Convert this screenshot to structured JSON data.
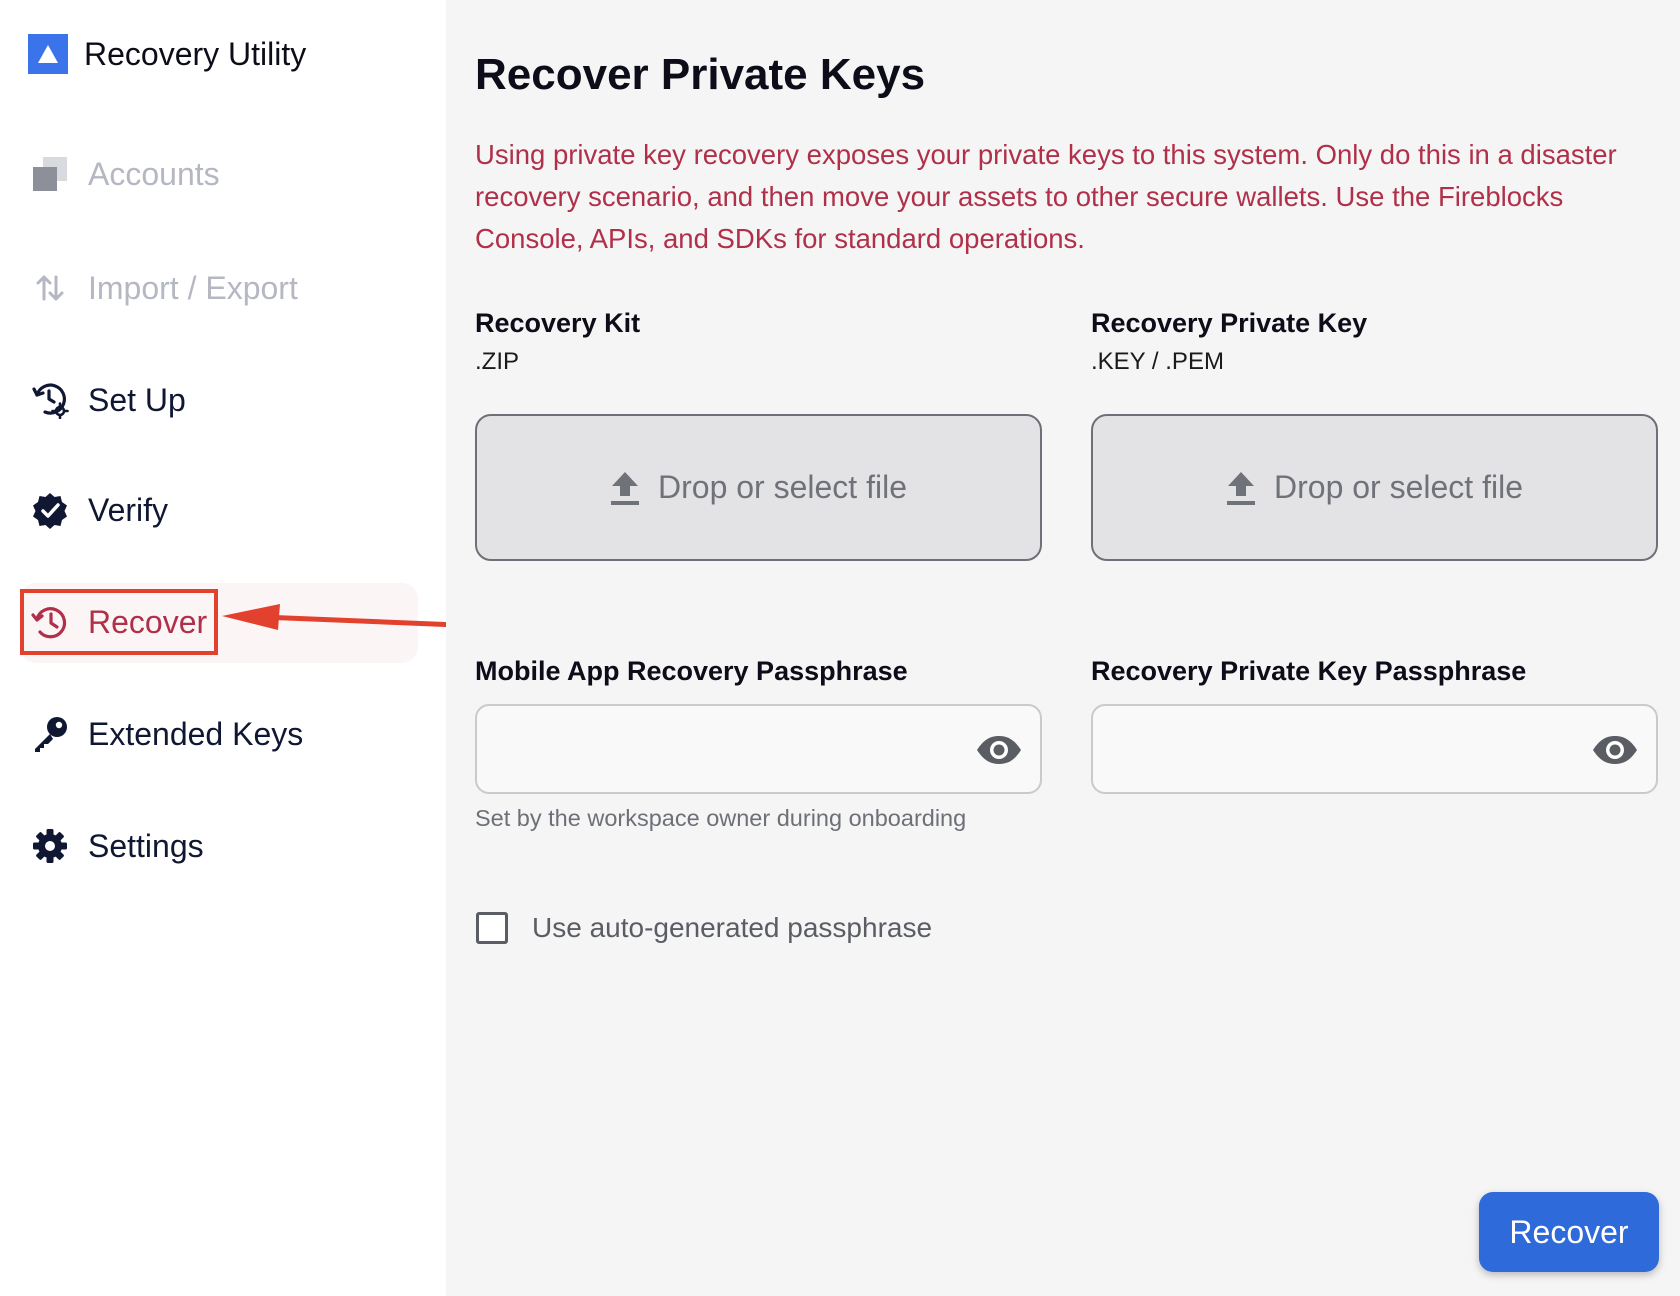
{
  "app": {
    "title": "Recovery Utility"
  },
  "sidebar": {
    "items": [
      {
        "label": "Accounts",
        "icon": "accounts-icon",
        "state": "disabled"
      },
      {
        "label": "Import / Export",
        "icon": "import-export-icon",
        "state": "disabled"
      },
      {
        "label": "Set Up",
        "icon": "setup-icon",
        "state": "normal"
      },
      {
        "label": "Verify",
        "icon": "verified-badge-icon",
        "state": "normal"
      },
      {
        "label": "Recover",
        "icon": "history-icon",
        "state": "active"
      },
      {
        "label": "Extended Keys",
        "icon": "key-icon",
        "state": "normal"
      },
      {
        "label": "Settings",
        "icon": "gear-icon",
        "state": "normal"
      }
    ]
  },
  "main": {
    "title": "Recover Private Keys",
    "warning": "Using private key recovery exposes your private keys to this system. Only do this in a disaster recovery scenario, and then move your assets to other secure wallets. Use the Fireblocks Console, APIs, and SDKs for standard operations.",
    "recovery_kit": {
      "label": "Recovery Kit",
      "formats": ".ZIP",
      "dropzone_text": "Drop or select file"
    },
    "private_key": {
      "label": "Recovery Private Key",
      "formats": ".KEY / .PEM",
      "dropzone_text": "Drop or select file"
    },
    "mobile_passphrase": {
      "label": "Mobile App Recovery Passphrase",
      "value": "",
      "helper": "Set by the workspace owner during onboarding"
    },
    "key_passphrase": {
      "label": "Recovery Private Key Passphrase",
      "value": ""
    },
    "auto_passphrase": {
      "label": "Use auto-generated passphrase",
      "checked": false
    },
    "submit_label": "Recover"
  },
  "colors": {
    "accent": "#2e6ad9",
    "warning": "#b0304a",
    "annotation": "#e2422d"
  }
}
